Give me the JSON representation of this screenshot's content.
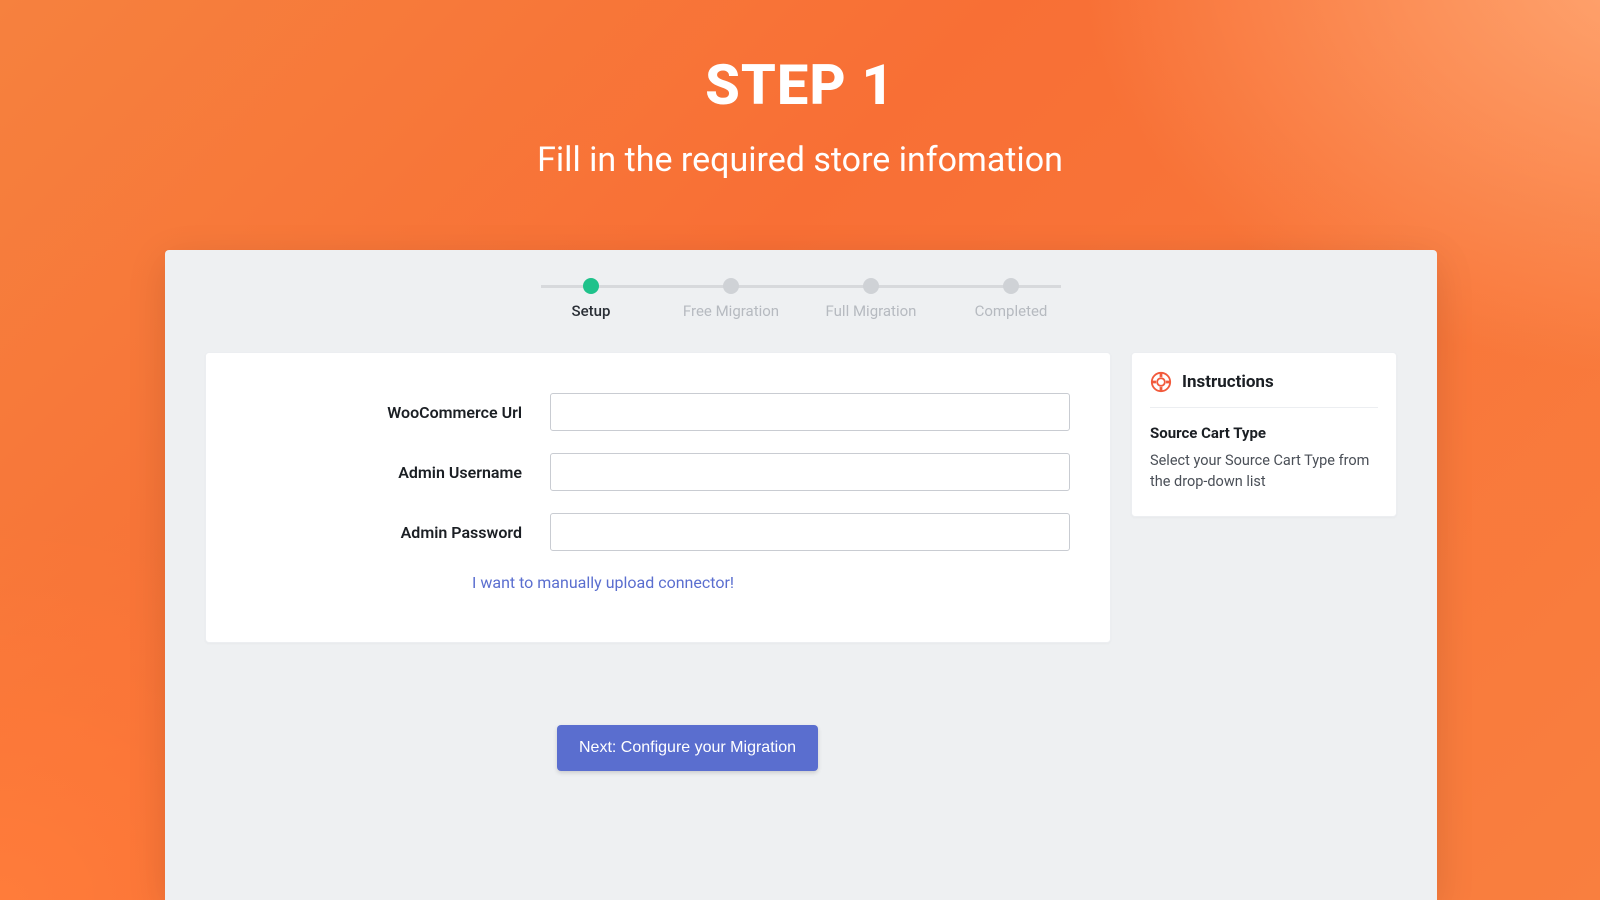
{
  "header": {
    "title": "STEP 1",
    "subtitle": "Fill in the required store infomation"
  },
  "stepper": {
    "steps": [
      {
        "label": "Setup",
        "active": true
      },
      {
        "label": "Free Migration",
        "active": false
      },
      {
        "label": "Full Migration",
        "active": false
      },
      {
        "label": "Completed",
        "active": false
      }
    ]
  },
  "form": {
    "url_label": "WooCommerce Url",
    "url_value": "",
    "user_label": "Admin Username",
    "user_value": "",
    "pass_label": "Admin Password",
    "pass_value": "",
    "manual_link": "I want to manually upload connector!"
  },
  "instructions": {
    "heading": "Instructions",
    "title": "Source Cart Type",
    "body": "Select your Source Cart Type from the drop-down list"
  },
  "next_button": "Next: Configure your Migration",
  "colors": {
    "accent_orange": "#f97f3f",
    "accent_green": "#1fc28b",
    "primary_btn": "#5a6ecf"
  }
}
